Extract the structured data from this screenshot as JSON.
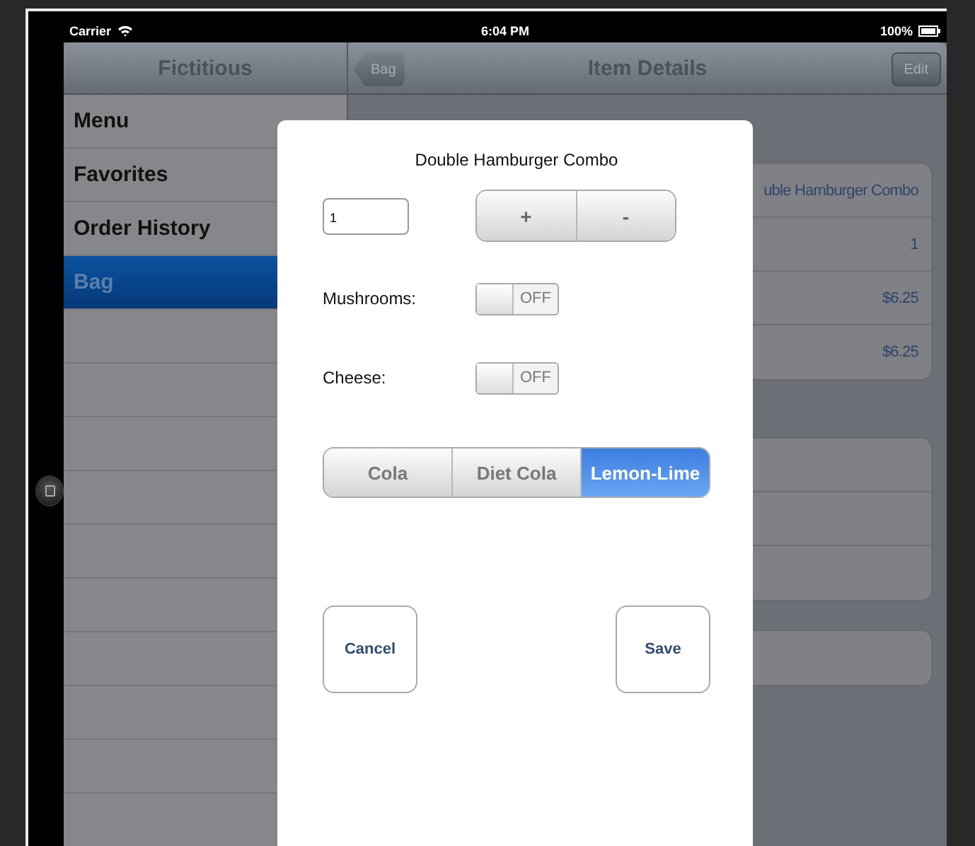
{
  "status_bar": {
    "carrier": "Carrier",
    "time": "6:04 PM",
    "battery": "100%"
  },
  "master": {
    "title": "Fictitious",
    "items": [
      {
        "label": "Menu",
        "selected": false
      },
      {
        "label": "Favorites",
        "selected": false
      },
      {
        "label": "Order History",
        "selected": false
      },
      {
        "label": "Bag",
        "selected": true
      }
    ]
  },
  "detail": {
    "back_button": "Bag",
    "title": "Item Details",
    "edit_button": "Edit",
    "rows": [
      "uble Hamburger Combo",
      "1",
      "$6.25",
      "$6.25"
    ]
  },
  "modal": {
    "title": "Double Hamburger Combo",
    "quantity": "1",
    "stepper": [
      "+",
      "-"
    ],
    "options": [
      {
        "label": "Mushrooms:",
        "on": false,
        "state_text": "OFF"
      },
      {
        "label": "Cheese:",
        "on": false,
        "state_text": "OFF"
      }
    ],
    "drinks": [
      {
        "label": "Cola",
        "selected": false
      },
      {
        "label": "Diet Cola",
        "selected": false
      },
      {
        "label": "Lemon-Lime",
        "selected": true
      }
    ],
    "cancel": "Cancel",
    "save": "Save"
  }
}
